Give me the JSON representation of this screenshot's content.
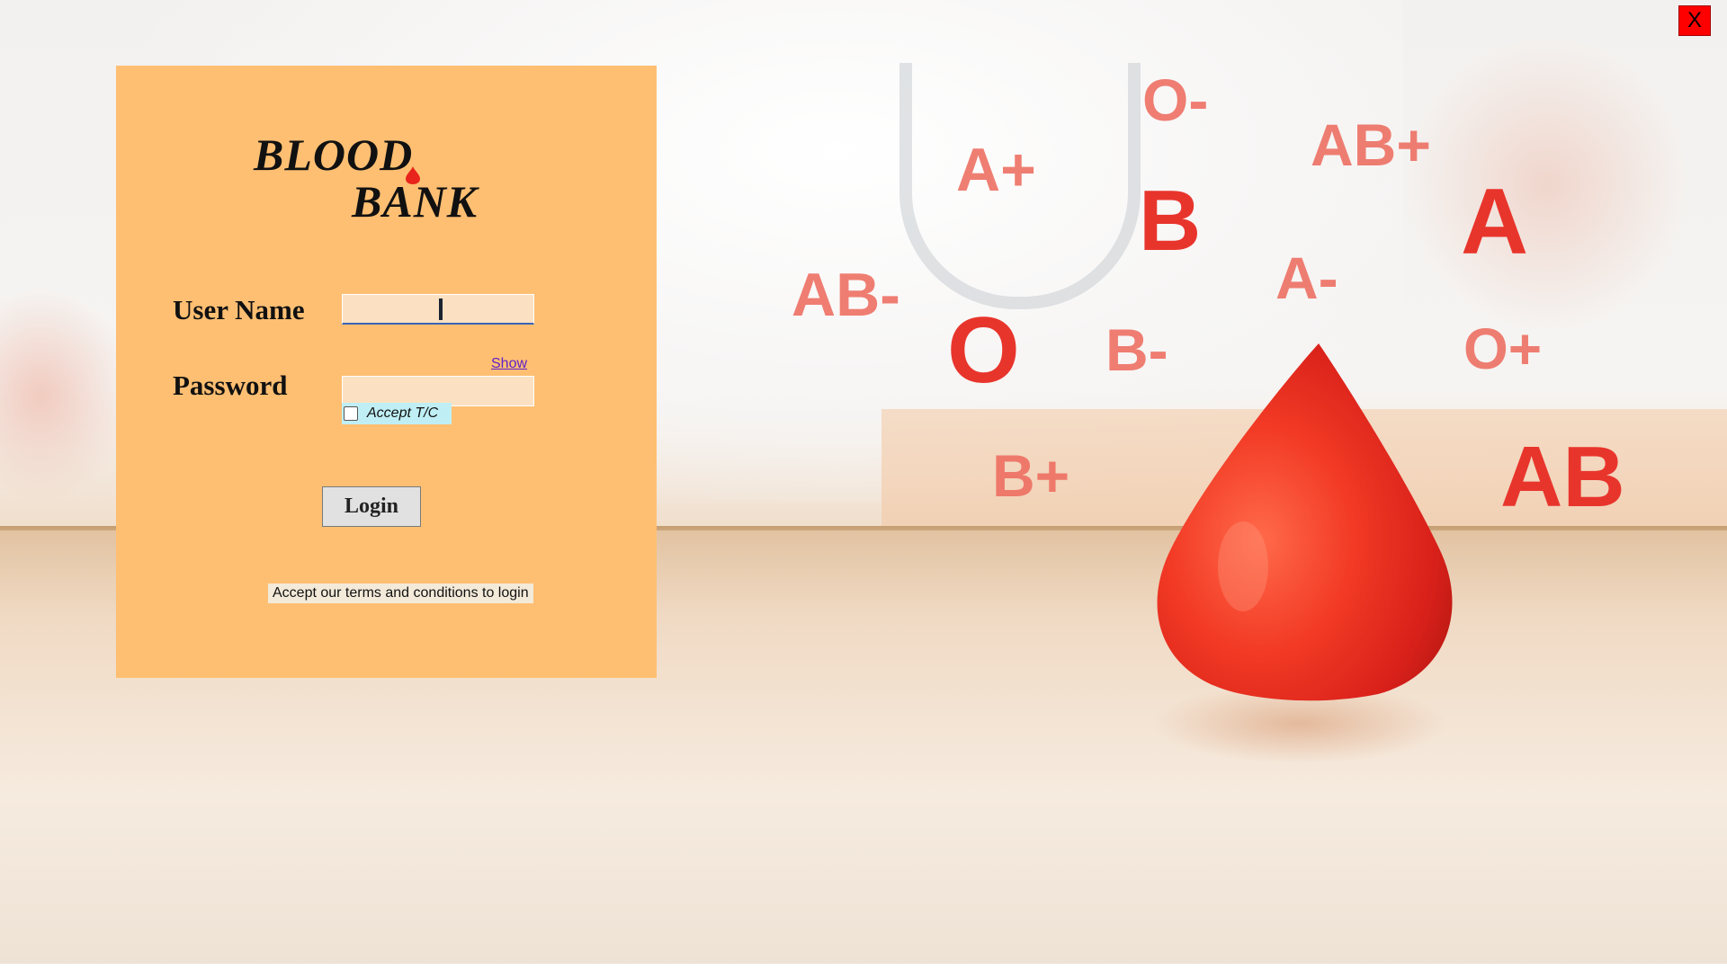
{
  "app": {
    "close_label": "X"
  },
  "logo": {
    "line1": "BLOOD",
    "line2": "BANK"
  },
  "form": {
    "username_label": "User Name",
    "username_value": "",
    "password_label": "Password",
    "password_value": "",
    "show_link": "Show",
    "accept_label": "Accept T/C",
    "accept_checked": false,
    "login_label": "Login",
    "note": "Accept our terms and conditions to login"
  },
  "background": {
    "blood_types": [
      "O-",
      "AB+",
      "A+",
      "B",
      "A",
      "AB-",
      "A-",
      "O",
      "B-",
      "O+",
      "B+",
      "AB"
    ]
  },
  "colors": {
    "panel": "#ffbf72",
    "close_button": "#ff0000",
    "blood_red": "#e8352c",
    "link": "#6020c8",
    "input_bg": "#fbe1c2"
  }
}
